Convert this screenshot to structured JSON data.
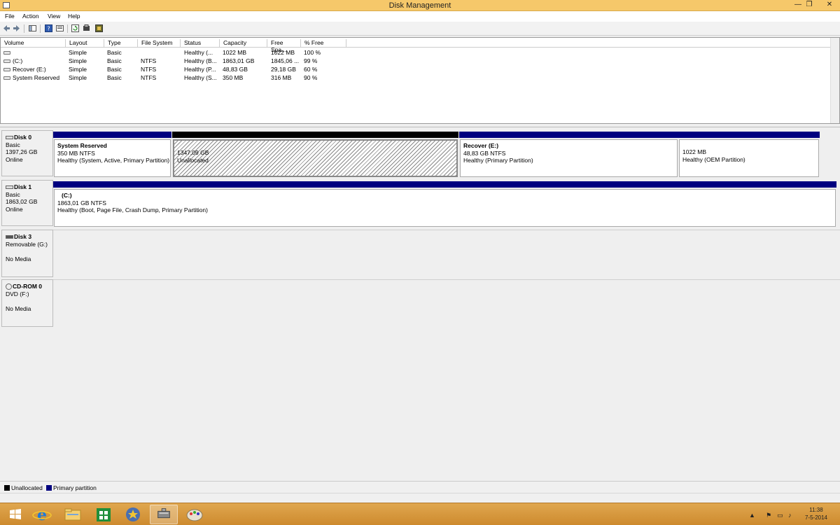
{
  "window": {
    "title": "Disk Management",
    "minimize": "—",
    "maximize": "❐",
    "close": "✕"
  },
  "menu": [
    "File",
    "Action",
    "View",
    "Help"
  ],
  "toolbar": {
    "icons": [
      "back-icon",
      "forward-icon",
      "show-hide-console-tree-icon",
      "help-icon",
      "properties-icon",
      "refresh-icon",
      "rescan-disks-icon",
      "settings-icon"
    ]
  },
  "volume_list": {
    "columns": [
      "Volume",
      "Layout",
      "Type",
      "File System",
      "Status",
      "Capacity",
      "Free Spa...",
      "% Free"
    ],
    "rows": [
      {
        "volume": "",
        "layout": "Simple",
        "type": "Basic",
        "fs": "",
        "status": "Healthy (...",
        "capacity": "1022 MB",
        "free": "1022 MB",
        "pct": "100 %"
      },
      {
        "volume": "(C:)",
        "layout": "Simple",
        "type": "Basic",
        "fs": "NTFS",
        "status": "Healthy (B...",
        "capacity": "1863,01 GB",
        "free": "1845,06 ...",
        "pct": "99 %"
      },
      {
        "volume": "Recover (E:)",
        "layout": "Simple",
        "type": "Basic",
        "fs": "NTFS",
        "status": "Healthy (P...",
        "capacity": "48,83 GB",
        "free": "29,18 GB",
        "pct": "60 %"
      },
      {
        "volume": "System Reserved",
        "layout": "Simple",
        "type": "Basic",
        "fs": "NTFS",
        "status": "Healthy (S...",
        "capacity": "350 MB",
        "free": "316 MB",
        "pct": "90 %"
      }
    ]
  },
  "disks": [
    {
      "name": "Disk 0",
      "line1": "Basic",
      "line2": "1397,26 GB",
      "line3": "Online",
      "partitions": [
        {
          "name": "System Reserved",
          "size": "350 MB NTFS",
          "status": "Healthy (System, Active, Primary Partition)",
          "kind": "primary"
        },
        {
          "name": "",
          "size": "1347,09 GB",
          "status": "Unallocated",
          "kind": "unallocated"
        },
        {
          "name": "Recover  (E:)",
          "size": "48,83 GB NTFS",
          "status": "Healthy (Primary Partition)",
          "kind": "primary"
        },
        {
          "name": "",
          "size": "1022 MB",
          "status": "Healthy (OEM Partition)",
          "kind": "primary"
        }
      ]
    },
    {
      "name": "Disk 1",
      "line1": "Basic",
      "line2": "1863,02 GB",
      "line3": "Online",
      "partitions": [
        {
          "name": "(C:)",
          "size": "1863,01 GB NTFS",
          "status": "Healthy (Boot, Page File, Crash Dump, Primary Partition)",
          "kind": "primary"
        }
      ]
    },
    {
      "name": "Disk 3",
      "line1": "Removable (G:)",
      "line2": "",
      "line3": "No Media",
      "partitions": []
    },
    {
      "name": "CD-ROM 0",
      "line1": "DVD (F:)",
      "line2": "",
      "line3": "No Media",
      "partitions": []
    }
  ],
  "legend": [
    {
      "label": "Unallocated",
      "color": "#000000"
    },
    {
      "label": "Primary partition",
      "color": "#00007f"
    }
  ],
  "taskbar": {
    "apps": [
      "start-icon",
      "internet-explorer-icon",
      "file-explorer-icon",
      "store-icon",
      "favorites-app-icon",
      "disk-management-icon",
      "paint-icon"
    ],
    "clock_time": "11:38",
    "clock_date": "7-5-2014"
  }
}
